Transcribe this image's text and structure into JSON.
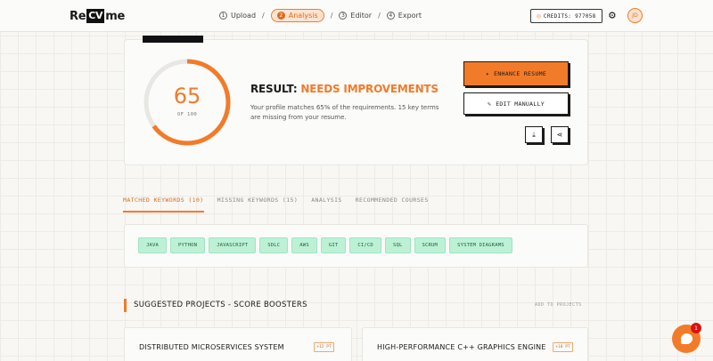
{
  "header": {
    "logo": {
      "pre": "Re",
      "box": "CV",
      "post": "me"
    },
    "steps": [
      {
        "num": "1",
        "label": "Upload"
      },
      {
        "num": "2",
        "label": "Analysis"
      },
      {
        "num": "3",
        "label": "Editor"
      },
      {
        "num": "4",
        "label": "Export"
      }
    ],
    "credits": "CREDITS: 977058",
    "avatar": "JD"
  },
  "score": {
    "value": "65",
    "of": "OF 100",
    "fraction": 0.65,
    "result_prefix": "RESULT:",
    "result_status": "NEEDS IMPROVEMENTS",
    "description": "Your profile matches 65% of the requirements. 15 key terms are missing from your resume."
  },
  "actions": {
    "enhance": "ENHANCE RESUME",
    "edit": "EDIT MANUALLY"
  },
  "tabs": [
    "MATCHED KEYWORDS (10)",
    "MISSING KEYWORDS (15)",
    "ANALYSIS",
    "RECOMMENDED COURSES"
  ],
  "keywords": [
    "JAVA",
    "PYTHON",
    "JAVASCRIPT",
    "SDLC",
    "AWS",
    "GIT",
    "CI/CD",
    "SQL",
    "SCRUM",
    "SYSTEM DIAGRAMS"
  ],
  "projects": {
    "title": "SUGGESTED PROJECTS - SCORE BOOSTERS",
    "add_label": "ADD TO PROJECTS",
    "items": [
      {
        "name": "DISTRIBUTED MICROSERVICES SYSTEM",
        "points": "+12 PT"
      },
      {
        "name": "HIGH-PERFORMANCE C++ GRAPHICS ENGINE",
        "points": "+10 PT"
      }
    ]
  },
  "chat": {
    "badge": "1"
  },
  "colors": {
    "accent": "#f27b2a",
    "chip": "#bdf1d6",
    "chip_text": "#1f5e3e"
  }
}
